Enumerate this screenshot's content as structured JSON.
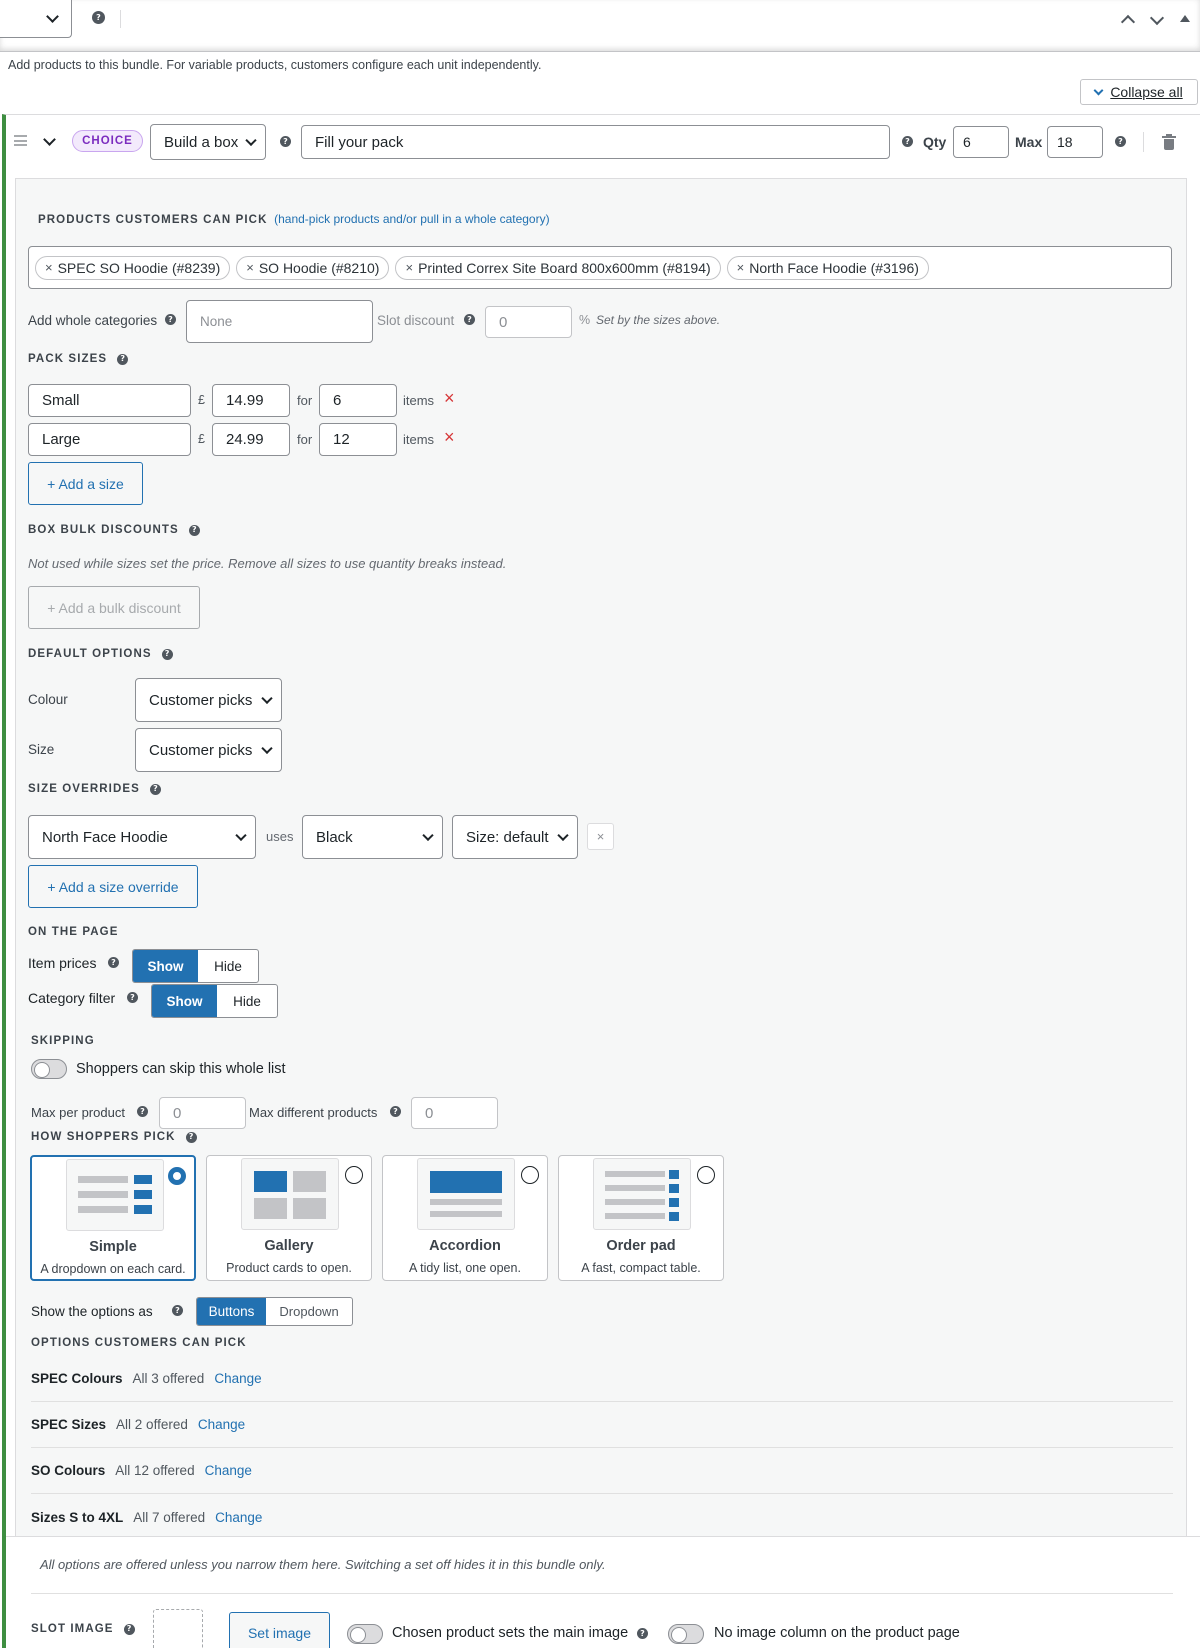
{
  "top_bar": {
    "help_tooltip": "?",
    "controls": [
      "move-up",
      "move-down",
      "toggle-panel"
    ]
  },
  "intro_text": "Add products to this bundle. For variable products, customers configure each unit independently.",
  "collapse_all_label": "Collapse all",
  "slot": {
    "badge": "CHOICE",
    "type_select": "Build a box",
    "title_value": "Fill your pack",
    "qty_label": "Qty",
    "qty_value": "6",
    "max_label": "Max",
    "max_value": "18"
  },
  "products": {
    "header": "PRODUCTS CUSTOMERS CAN PICK",
    "hint": "(hand-pick products and/or pull in a whole category)",
    "chips": [
      "SPEC SO Hoodie (#8239)",
      "SO Hoodie (#8210)",
      "Printed Correx Site Board 800x600mm (#8194)",
      "North Face Hoodie (#3196)"
    ],
    "remove_glyph": "×"
  },
  "categories": {
    "label": "Add whole categories",
    "placeholder": "None",
    "slot_discount_label": "Slot discount",
    "slot_discount_placeholder": "0",
    "percent": "%",
    "note": "Set by the sizes above."
  },
  "pack_sizes": {
    "header": "PACK SIZES",
    "currency": "£",
    "for_label": "for",
    "items_label": "items",
    "rows": [
      {
        "name": "Small",
        "price": "14.99",
        "qty": "6"
      },
      {
        "name": "Large",
        "price": "24.99",
        "qty": "12"
      }
    ],
    "remove_glyph": "×",
    "add_label": "+ Add a size"
  },
  "bulk": {
    "header": "BOX BULK DISCOUNTS",
    "note": "Not used while sizes set the price. Remove all sizes to use quantity breaks instead.",
    "add_label": "+ Add a bulk discount"
  },
  "defaults": {
    "header": "DEFAULT OPTIONS",
    "rows": [
      {
        "label": "Colour",
        "value": "Customer picks"
      },
      {
        "label": "Size",
        "value": "Customer picks"
      }
    ]
  },
  "overrides": {
    "header": "SIZE OVERRIDES",
    "product": "North Face Hoodie",
    "uses": "uses",
    "colour": "Black",
    "size": "Size: default",
    "remove_glyph": "×",
    "add_label": "+ Add a size override"
  },
  "on_page": {
    "header": "ON THE PAGE",
    "item_prices_label": "Item prices",
    "category_filter_label": "Category filter",
    "show": "Show",
    "hide": "Hide"
  },
  "skipping": {
    "header": "SKIPPING",
    "toggle_label": "Shoppers can skip this whole list",
    "max_per_product_label": "Max per product",
    "max_per_product_placeholder": "0",
    "max_different_label": "Max different products",
    "max_different_placeholder": "0"
  },
  "how_pick": {
    "header": "HOW SHOPPERS PICK",
    "cards": [
      {
        "title": "Simple",
        "sub": "A dropdown on each card.",
        "selected": true
      },
      {
        "title": "Gallery",
        "sub": "Product cards to open.",
        "selected": false
      },
      {
        "title": "Accordion",
        "sub": "A tidy list, one open.",
        "selected": false
      },
      {
        "title": "Order pad",
        "sub": "A fast, compact table.",
        "selected": false
      }
    ]
  },
  "show_options": {
    "label": "Show the options as",
    "buttons": "Buttons",
    "dropdown": "Dropdown"
  },
  "options": {
    "header": "OPTIONS CUSTOMERS CAN PICK",
    "change_label": "Change",
    "rows": [
      {
        "name": "SPEC Colours",
        "count": "All 3 offered"
      },
      {
        "name": "SPEC Sizes",
        "count": "All 2 offered"
      },
      {
        "name": "SO Colours",
        "count": "All 12 offered"
      },
      {
        "name": "Sizes S to 4XL",
        "count": "All 7 offered"
      }
    ],
    "note": "All options are offered unless you narrow them here. Switching a set off hides it in this bundle only."
  },
  "slot_image": {
    "header": "SLOT IMAGE",
    "set_label": "Set image",
    "main_image_label": "Chosen product sets the main image",
    "no_column_label": "No image column on the product page"
  },
  "colors": {
    "accent": "#2271b1",
    "badge_bg": "#f3eafc",
    "badge_text": "#7b2cbf",
    "left_rail": "#3e8e41",
    "danger": "#d63638"
  }
}
